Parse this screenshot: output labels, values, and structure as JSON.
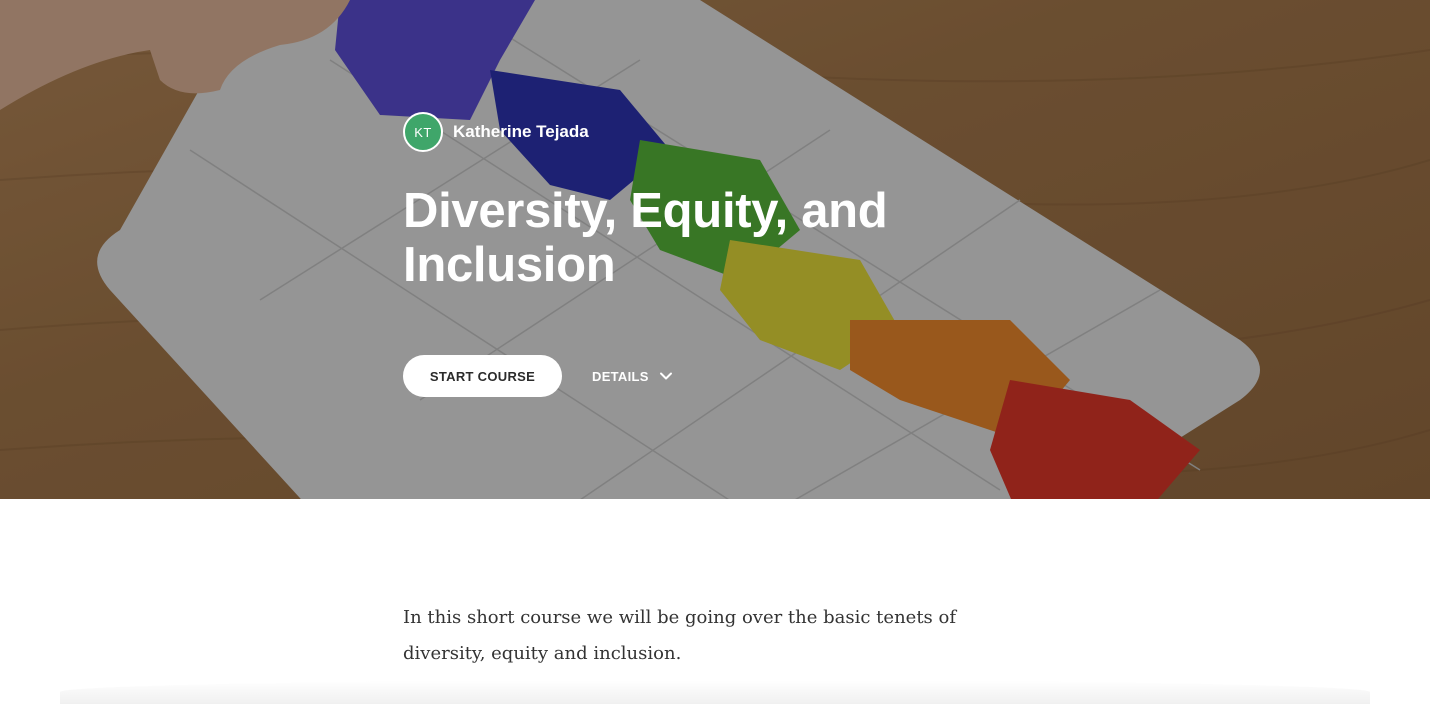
{
  "hero": {
    "image": "colorful-puzzle-pieces-photo",
    "author": {
      "initials": "KT",
      "name": "Katherine Tejada",
      "avatar_color": "#3fa66a"
    },
    "title": "Diversity, Equity, and Inclusion",
    "start_button": "START COURSE",
    "details_button": "DETAILS",
    "details_icon": "chevron-down-icon"
  },
  "description": "In this short course we will be going over the basic tenets of diversity, equity and inclusion."
}
